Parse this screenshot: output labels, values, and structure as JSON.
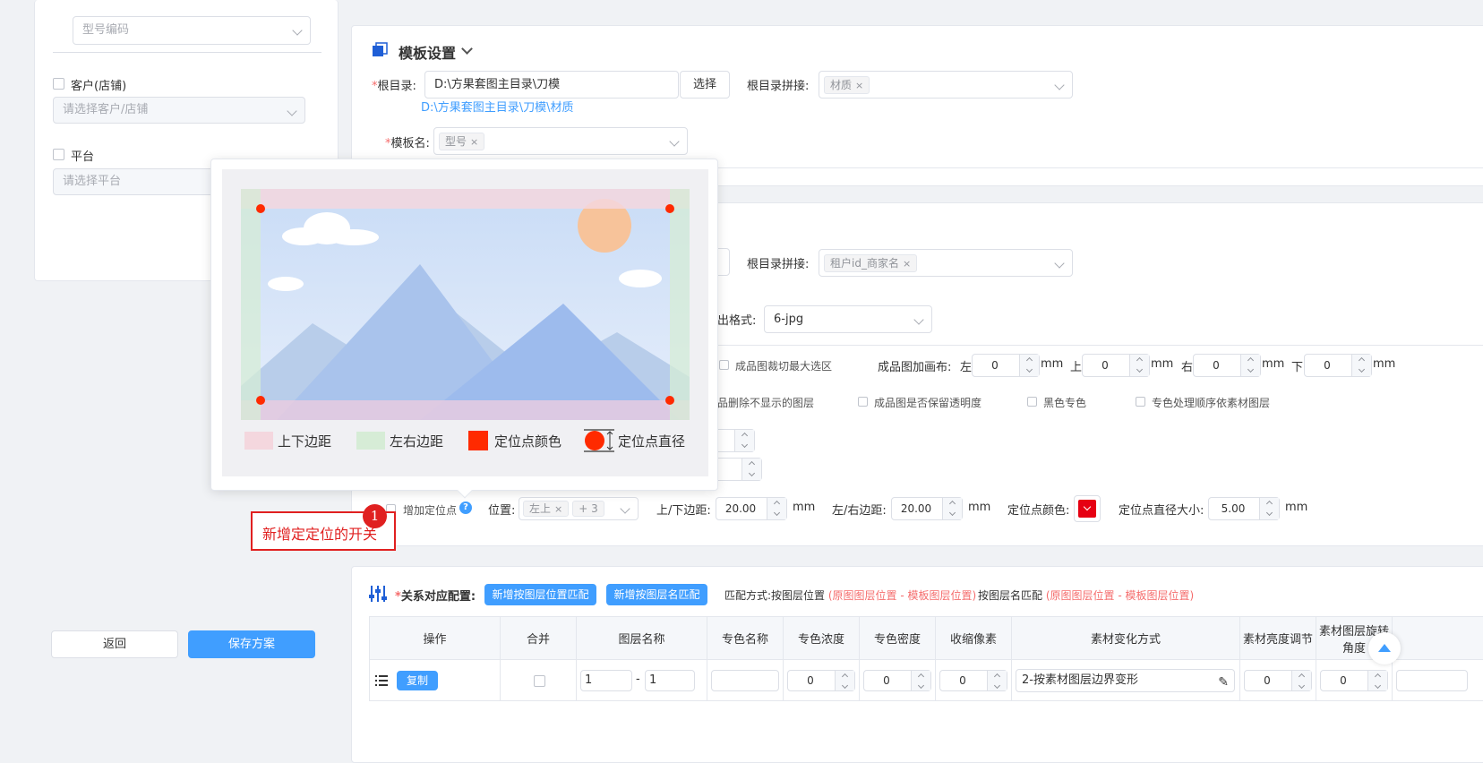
{
  "left_panel": {
    "model_code_placeholder": "型号编码",
    "customer_label": "客户(店铺)",
    "customer_placeholder": "请选择客户/店铺",
    "platform_label": "平台",
    "platform_placeholder": "请选择平台",
    "back_button": "返回",
    "save_button": "保存方案"
  },
  "template_settings": {
    "title": "模板设置",
    "root_dir_label": "根目录:",
    "root_dir_value": "D:\\方果套图主目录\\刀模",
    "select_button": "选择",
    "root_join_label": "根目录拼接:",
    "root_join_tag": "材质",
    "root_dir_preview": "D:\\方果套图主目录\\刀模\\材质",
    "template_name_label": "模板名:",
    "template_name_tag": "型号"
  },
  "output_settings": {
    "root_join_label": "根目录拼接:",
    "root_join_tag": "租户id_商家名",
    "format_label": "出格式:",
    "format_value": "6-jpg",
    "crop_max_label": "成品图裁切最大选区",
    "canvas_label": "成品图加画布:",
    "left_label": "左",
    "left_value": "0",
    "top_label": "上",
    "top_value": "0",
    "right_label": "右",
    "right_value": "0",
    "bottom_label": "下",
    "bottom_value": "0",
    "unit": "mm",
    "delete_hidden_label": "品删除不显示的图层",
    "keep_transparency_label": "成品图是否保留透明度",
    "black_spot_label": "黑色专色",
    "spot_order_label": "专色处理顺序依素材图层",
    "add_locate_label": "增加定位点",
    "position_label": "位置:",
    "position_tag": "左上",
    "position_more": "+ 3",
    "tb_margin_label": "上/下边距:",
    "tb_margin_value": "20.00",
    "lr_margin_label": "左/右边距:",
    "lr_margin_value": "20.00",
    "locate_color_label": "定位点颜色:",
    "locate_color": "#e60012",
    "locate_diameter_label": "定位点直径大小:",
    "locate_diameter_value": "5.00"
  },
  "popover": {
    "legend": [
      "上下边距",
      "左右边距",
      "定位点颜色",
      "定位点直径"
    ],
    "colors": {
      "tb": "#f4d7de",
      "lr": "#d6ecd6",
      "dot": "#ff2a00"
    }
  },
  "annotation": {
    "badge": "1",
    "text": "新增定定位的开关"
  },
  "relation": {
    "label": "关系对应配置:",
    "btn_position": "新增按图层位置匹配",
    "btn_name": "新增按图层名匹配",
    "match_position_text": "匹配方式:按图层位置",
    "match_position_note": "(原图图层位置 - 模板图层位置)",
    "match_name_text": "按图层名匹配",
    "match_name_note": "(原图图层位置 - 模板图层位置)",
    "columns": [
      "操作",
      "合并",
      "图层名称",
      "专色名称",
      "专色浓度",
      "专色密度",
      "收缩像素",
      "素材变化方式",
      "素材亮度调节",
      "素材图层旋转角度"
    ],
    "row": {
      "copy_button": "复制",
      "layer_from": "1",
      "layer_sep": "-",
      "layer_to": "1",
      "spot_density": "0",
      "spot_thickness": "0",
      "shrink": "0",
      "material_mode": "2-按素材图层边界变形",
      "brightness": "0",
      "rotation": "0"
    }
  }
}
